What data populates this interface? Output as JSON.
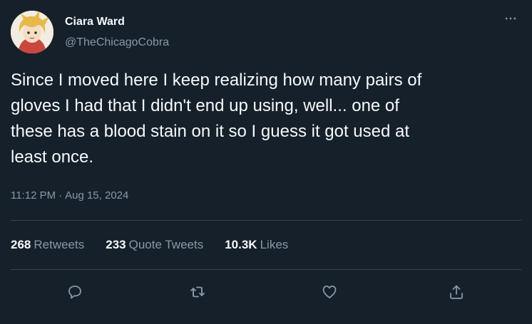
{
  "author": {
    "display_name": "Ciara Ward",
    "handle": "@TheChicagoCobra",
    "avatar_icon": "avatar-illustration"
  },
  "tweet": {
    "text": "Since I moved here I keep realizing how many pairs of\ngloves I had that I didn't end up using, well... one of\nthese has a blood stain on it so I guess it got used at\nleast once.",
    "time": "11:12 PM",
    "separator": "·",
    "date": "Aug 15, 2024"
  },
  "stats": {
    "retweets": {
      "count": "268",
      "label": "Retweets"
    },
    "quotes": {
      "count": "233",
      "label": "Quote Tweets"
    },
    "likes": {
      "count": "10.3K",
      "label": "Likes"
    }
  },
  "actions": {
    "reply_icon": "reply-icon",
    "retweet_icon": "retweet-icon",
    "like_icon": "heart-icon",
    "share_icon": "share-icon"
  },
  "colors": {
    "background": "#15202b",
    "text_primary": "#f7f9f9",
    "text_secondary": "#8b98a5",
    "divider": "#38444d"
  }
}
